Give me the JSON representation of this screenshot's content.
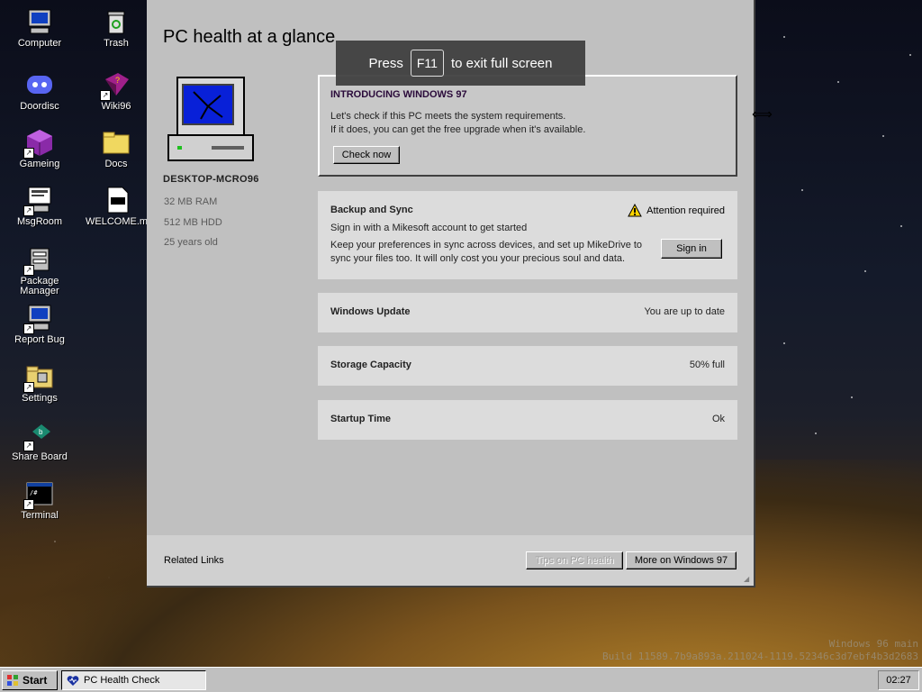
{
  "desktop": {
    "icons": [
      {
        "label": "Computer"
      },
      {
        "label": "Trash"
      },
      {
        "label": "Doordisc"
      },
      {
        "label": "Wiki96"
      },
      {
        "label": "Gameing"
      },
      {
        "label": "Docs"
      },
      {
        "label": "MsgRoom"
      },
      {
        "label": "WELCOME.md"
      },
      {
        "label": "Package Manager"
      },
      {
        "label": "Report Bug"
      },
      {
        "label": "Settings"
      },
      {
        "label": "Share Board"
      },
      {
        "label": "Terminal"
      }
    ],
    "build_line1": "Windows 96 main",
    "build_line2": "Build 11589.7b9a893a.211024-1119.52346c3d7ebf4b3d2683"
  },
  "window": {
    "title": "PC health at a glance",
    "pc": {
      "name": "DESKTOP-MCRO96",
      "ram": "32 MB RAM",
      "hdd": "512 MB HDD",
      "age": "25 years old"
    },
    "intro": {
      "heading": "INTRODUCING WINDOWS 97",
      "line1": "Let's check if this PC meets the system requirements.",
      "line2": "If it does, you can get the free upgrade when it's available.",
      "button": "Check now"
    },
    "backup": {
      "title": "Backup and Sync",
      "status": "Attention required",
      "line1": "Sign in with a Mikesoft account to get started",
      "line2": "Keep your preferences in sync across devices, and set up MikeDrive to",
      "line3": "sync your files too. It will only cost you your precious soul and data.",
      "button": "Sign in"
    },
    "update": {
      "title": "Windows Update",
      "value": "You are up to date"
    },
    "storage": {
      "title": "Storage Capacity",
      "value": "50% full"
    },
    "startup": {
      "title": "Startup Time",
      "value": "Ok"
    },
    "footer": {
      "related": "Related Links",
      "tips_button": "Tips on PC health",
      "more_button": "More on Windows 97"
    }
  },
  "toast": {
    "press": "Press",
    "key": "F11",
    "rest": "to exit full screen"
  },
  "taskbar": {
    "start_label": "Start",
    "task_label": "PC Health Check",
    "clock": "02:27"
  },
  "colors": {
    "window_bg": "#c0c0c0",
    "heading": "#2a0a3a",
    "warning": "#ffd400"
  }
}
